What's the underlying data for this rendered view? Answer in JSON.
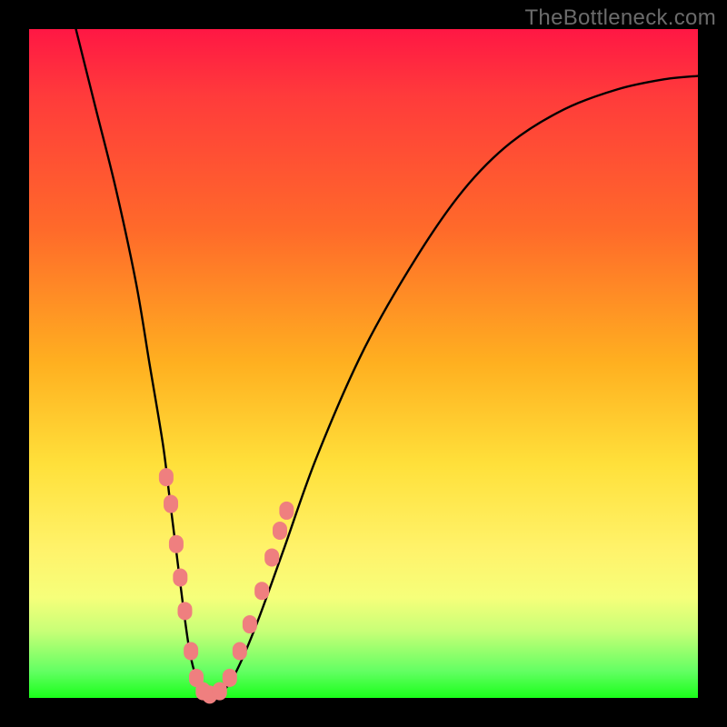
{
  "watermark": "TheBottleneck.com",
  "chart_data": {
    "type": "line",
    "title": "",
    "xlabel": "",
    "ylabel": "",
    "xlim": [
      0,
      100
    ],
    "ylim": [
      0,
      100
    ],
    "grid": false,
    "legend": false,
    "series": [
      {
        "name": "bottleneck-curve",
        "color": "#000000",
        "x": [
          7,
          10,
          13,
          16,
          18,
          20,
          21,
          22,
          23,
          24,
          25,
          26,
          27,
          29,
          31,
          34,
          38,
          43,
          50,
          58,
          65,
          72,
          80,
          88,
          95,
          100
        ],
        "y": [
          100,
          88,
          76,
          62,
          50,
          38,
          30,
          22,
          14,
          7,
          3,
          1,
          0,
          1,
          4,
          11,
          22,
          36,
          52,
          66,
          76,
          83,
          88,
          91,
          92.5,
          93
        ]
      }
    ],
    "markers": [
      {
        "name": "highlight-dots",
        "color": "#ef7f7f",
        "shape": "rounded",
        "points": [
          {
            "x": 20.5,
            "y": 33
          },
          {
            "x": 21.2,
            "y": 29
          },
          {
            "x": 22.0,
            "y": 23
          },
          {
            "x": 22.6,
            "y": 18
          },
          {
            "x": 23.3,
            "y": 13
          },
          {
            "x": 24.2,
            "y": 7
          },
          {
            "x": 25.0,
            "y": 3
          },
          {
            "x": 26.0,
            "y": 1
          },
          {
            "x": 27.0,
            "y": 0.5
          },
          {
            "x": 28.5,
            "y": 1
          },
          {
            "x": 30.0,
            "y": 3
          },
          {
            "x": 31.5,
            "y": 7
          },
          {
            "x": 33.0,
            "y": 11
          },
          {
            "x": 34.8,
            "y": 16
          },
          {
            "x": 36.3,
            "y": 21
          },
          {
            "x": 37.5,
            "y": 25
          },
          {
            "x": 38.5,
            "y": 28
          }
        ]
      }
    ]
  }
}
